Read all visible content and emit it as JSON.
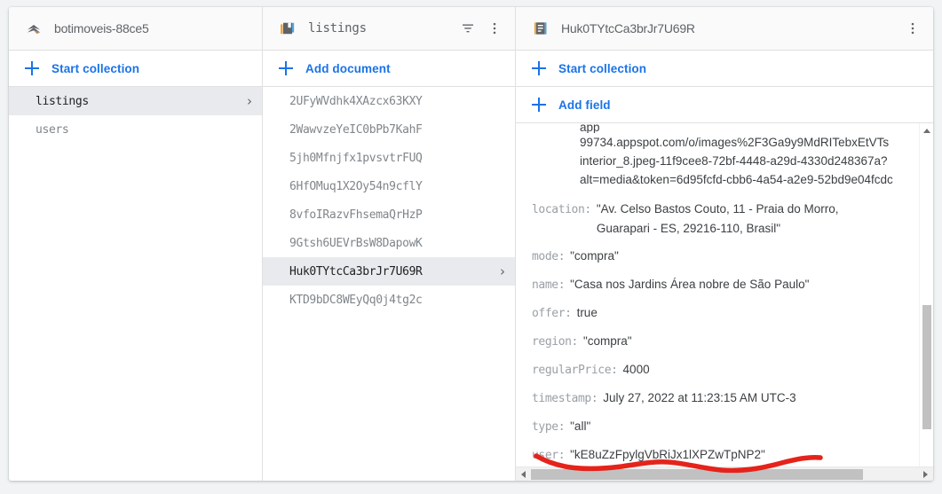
{
  "project_panel": {
    "icon": "firebase-project-icon",
    "title": "botimoveis-88ce5",
    "start_collection_label": "Start collection",
    "collections": [
      {
        "name": "listings",
        "selected": true,
        "chevron": "›"
      },
      {
        "name": "users",
        "selected": false,
        "chevron": ""
      }
    ]
  },
  "collection_panel": {
    "icon": "collection-icon",
    "title": "listings",
    "filter_icon": "filter-icon",
    "menu_icon": "kebab-menu-icon",
    "add_document_label": "Add document",
    "documents": [
      {
        "id": "2UFyWVdhk4XAzcx63KXY",
        "selected": false,
        "chevron": ""
      },
      {
        "id": "2WawvzeYeIC0bPb7KahF",
        "selected": false,
        "chevron": ""
      },
      {
        "id": "5jh0Mfnjfx1pvsvtrFUQ",
        "selected": false,
        "chevron": ""
      },
      {
        "id": "6HfOMuq1X2Oy54n9cflY",
        "selected": false,
        "chevron": ""
      },
      {
        "id": "8vfoIRazvFhsemaQrHzP",
        "selected": false,
        "chevron": ""
      },
      {
        "id": "9Gtsh6UEVrBsW8DapowK",
        "selected": false,
        "chevron": ""
      },
      {
        "id": "Huk0TYtcCa3brJr7U69R",
        "selected": true,
        "chevron": "›"
      },
      {
        "id": "KTD9bDC8WEyQq0j4tg2c",
        "selected": false,
        "chevron": ""
      }
    ]
  },
  "document_panel": {
    "icon": "document-icon",
    "title": "Huk0TYtcCa3brJr7U69R",
    "menu_icon": "kebab-menu-icon",
    "start_collection_label": "Start collection",
    "add_field_label": "Add field",
    "clipped_top_line": "app",
    "url_lines": [
      "99734.appspot.com/o/images%2F3Ga9y9MdRITebxEtVTs",
      "interior_8.jpeg-11f9cee8-72bf-4448-a29d-4330d248367a?",
      "alt=media&token=6d95fcfd-cbb6-4a54-a2e9-52bd9e04fcdc"
    ],
    "fields": [
      {
        "key": "location:",
        "value": "\"Av. Celso Bastos Couto, 11 - Praia do Morro,\nGuarapari - ES, 29216-110, Brasil\""
      },
      {
        "key": "mode:",
        "value": "\"compra\""
      },
      {
        "key": "name:",
        "value": "\"Casa nos Jardins Área nobre de São Paulo\""
      },
      {
        "key": "offer:",
        "value": "true"
      },
      {
        "key": "region:",
        "value": "\"compra\""
      },
      {
        "key": "regularPrice:",
        "value": "4000"
      },
      {
        "key": "timestamp:",
        "value": "July 27, 2022 at 11:23:15 AM UTC-3"
      },
      {
        "key": "type:",
        "value": "\"all\""
      },
      {
        "key": "user:",
        "value": "\"kE8uZzFpylgVbRiJx1lXPZwTpNP2\""
      }
    ]
  },
  "scrollbars": {
    "vertical_up_icon": "scroll-up-arrow-icon",
    "vertical_down_icon": "scroll-down-arrow-icon",
    "horizontal_left_icon": "scroll-left-arrow-icon",
    "horizontal_right_icon": "scroll-right-arrow-icon"
  },
  "annotation": {
    "type": "hand-drawn-underline",
    "color": "#e5231b",
    "target": "user field value"
  },
  "colors": {
    "accent_blue": "#1a73e8",
    "page_background": "#f1f3f4",
    "panel_background": "#ffffff",
    "header_background": "#fafafa",
    "selected_row": "#e8eaed",
    "key_text": "#9aa0a6",
    "value_text": "#3c4043",
    "annotation_red": "#e5231b"
  }
}
